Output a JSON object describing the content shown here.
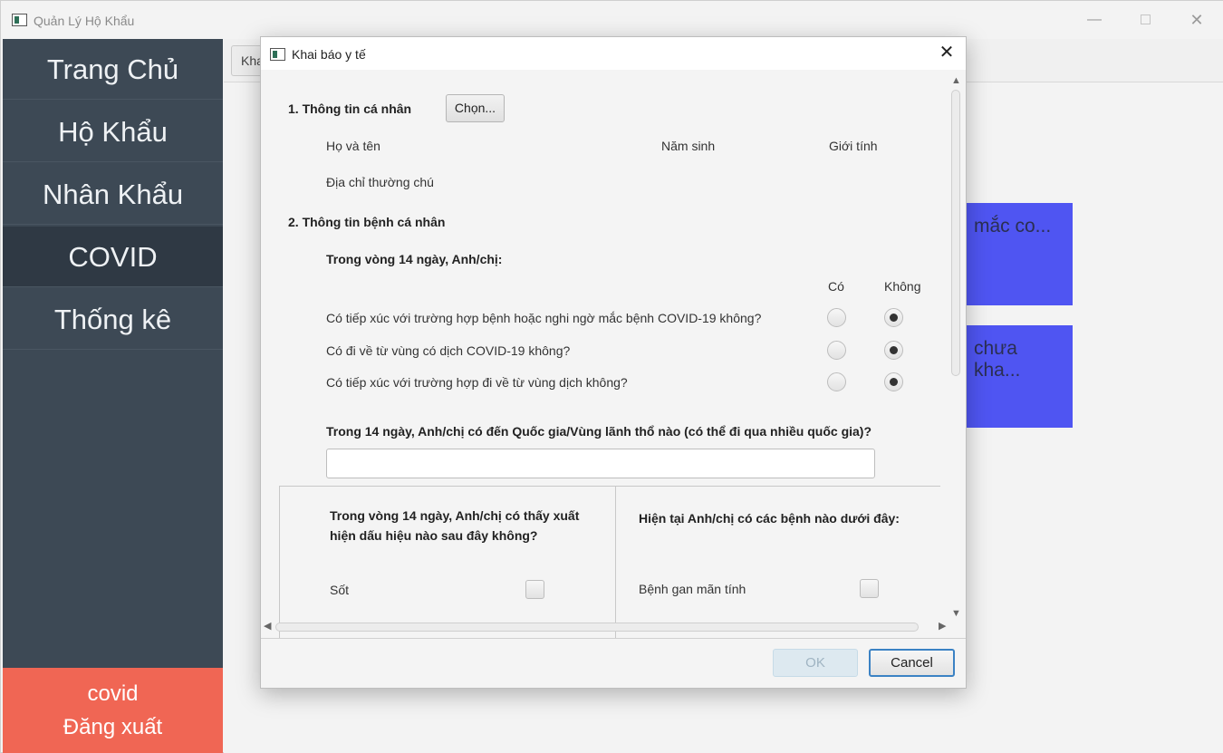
{
  "app": {
    "title": "Quản Lý Hộ Khẩu",
    "minimize_glyph": "—",
    "close_glyph": "✕"
  },
  "sidebar": {
    "items": [
      {
        "label": "Trang Chủ"
      },
      {
        "label": "Hộ Khẩu"
      },
      {
        "label": "Nhân Khẩu"
      },
      {
        "label": "COVID"
      },
      {
        "label": "Thống kê"
      }
    ],
    "active": "COVID",
    "user": "covid",
    "logout_label": "Đăng xuất"
  },
  "background": {
    "tab_label": "Kha",
    "card1_text": "mắc co...",
    "card2_text": "chưa kha..."
  },
  "dialog": {
    "title": "Khai báo y tế",
    "close_glyph": "✕",
    "section1": {
      "heading": "1. Thông tin cá nhân",
      "choose_button": "Chọn...",
      "field_name": "Họ và tên",
      "field_birth_year": "Năm sinh",
      "field_gender": "Giới tính",
      "field_address": "Địa chỉ thường chú"
    },
    "section2": {
      "heading": "2. Thông tin bệnh cá nhân",
      "sub_heading": "Trong vòng 14 ngày, Anh/chị:",
      "col_yes": "Có",
      "col_no": "Không",
      "questions": [
        {
          "text": "Có tiếp xúc với trường hợp bệnh hoặc nghi ngờ mắc bệnh COVID-19 không?",
          "answer": "Không"
        },
        {
          "text": "Có đi về từ vùng có dịch COVID-19 không?",
          "answer": "Không"
        },
        {
          "text": "Có tiếp xúc với trường hợp đi về từ vùng dịch không?",
          "answer": "Không"
        }
      ],
      "countries_question": "Trong 14 ngày, Anh/chị có đến Quốc gia/Vùng lãnh thổ nào (có thể đi qua nhiều quốc gia)?",
      "countries_value": "",
      "symptoms_heading_line1": "Trong vòng 14 ngày, Anh/chị có thấy xuất",
      "symptoms_heading_line2": "hiện dấu hiệu nào sau đây không?",
      "symptom_1": "Sốt",
      "symptom_1_checked": false,
      "diseases_heading": "Hiện tại Anh/chị có các bệnh nào dưới đây:",
      "disease_1": "Bệnh gan mãn tính",
      "disease_1_checked": false
    },
    "ok_label": "OK",
    "cancel_label": "Cancel"
  }
}
